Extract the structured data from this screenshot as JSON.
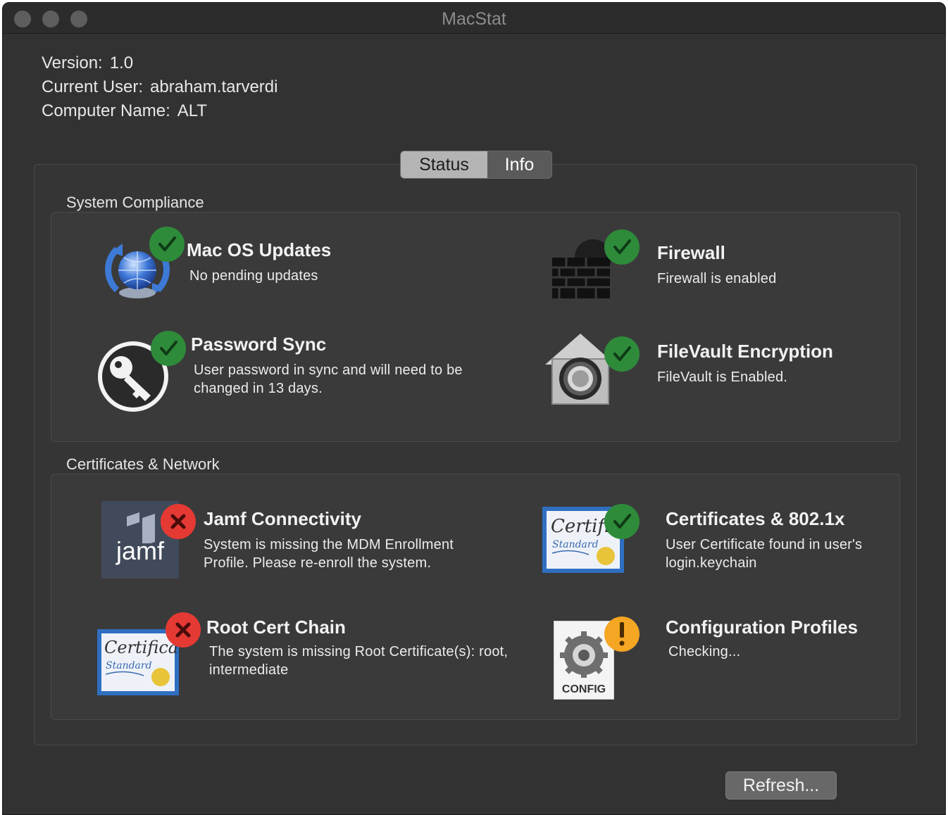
{
  "window": {
    "title": "MacStat"
  },
  "info": {
    "version_label": "Version:",
    "version_value": "1.0",
    "user_label": "Current User:",
    "user_value": "abraham.tarverdi",
    "computer_label": "Computer Name:",
    "computer_value": "ALT"
  },
  "tabs": [
    {
      "label": "Status",
      "selected": true
    },
    {
      "label": "Info",
      "selected": false
    }
  ],
  "system_compliance": {
    "label": "System Compliance",
    "items": [
      {
        "title": "Mac OS Updates",
        "desc": "No pending updates",
        "status": "ok",
        "icon": "software-update-icon"
      },
      {
        "title": "Firewall",
        "desc": "Firewall is enabled",
        "status": "ok",
        "icon": "firewall-icon"
      },
      {
        "title": "Password Sync",
        "desc": "User password in sync and will need to be changed in  13 days.",
        "status": "ok",
        "icon": "key-icon"
      },
      {
        "title": "FileVault Encryption",
        "desc": "FileVault is Enabled.",
        "status": "ok",
        "icon": "filevault-icon"
      }
    ]
  },
  "certificates_network": {
    "label": "Certificates & Network",
    "items": [
      {
        "title": "Jamf Connectivity",
        "desc": "System is missing the MDM Enrollment Profile.  Please re-enroll the system.",
        "status": "error",
        "icon": "jamf-icon",
        "icon_text": "jamf"
      },
      {
        "title": "Certificates & 802.1x",
        "desc": "User Certificate found in user's login.keychain",
        "status": "ok",
        "icon": "certificate-icon"
      },
      {
        "title": "Root Cert Chain",
        "desc": "The system is missing Root Certificate(s): root, intermediate",
        "status": "error",
        "icon": "certificate-icon"
      },
      {
        "title": "Configuration Profiles",
        "desc": "Checking...",
        "status": "warning",
        "icon": "config-profile-icon",
        "icon_text": "CONFIG"
      }
    ]
  },
  "refresh_button": {
    "label": "Refresh..."
  },
  "colors": {
    "ok": "#2e8b3a",
    "error": "#e53a34",
    "warning": "#f5a623",
    "window_bg": "#323232"
  }
}
